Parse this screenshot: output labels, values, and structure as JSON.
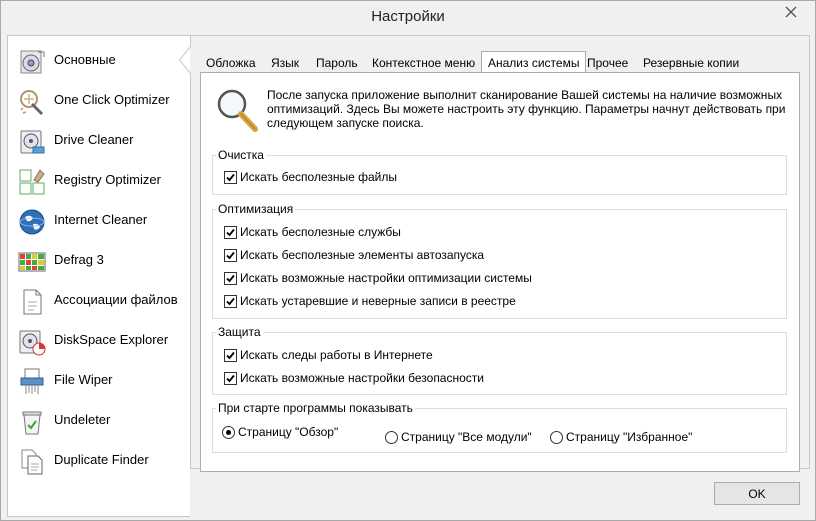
{
  "window": {
    "title": "Настройки"
  },
  "colors": {
    "accent": "#1e6fd9",
    "panel_border": "#acacac",
    "button_bg": "#e5e5e5"
  },
  "sidebar": {
    "items": [
      {
        "label": "Основные",
        "icon": "settings-disk-icon"
      },
      {
        "label": "One Click Optimizer",
        "icon": "magic-wand-icon"
      },
      {
        "label": "Drive Cleaner",
        "icon": "drive-cleaner-icon"
      },
      {
        "label": "Registry Optimizer",
        "icon": "registry-icon"
      },
      {
        "label": "Internet Cleaner",
        "icon": "globe-icon"
      },
      {
        "label": "Defrag 3",
        "icon": "defrag-grid-icon"
      },
      {
        "label": "Ассоциации файлов",
        "icon": "file-association-icon"
      },
      {
        "label": "DiskSpace Explorer",
        "icon": "disk-pie-icon"
      },
      {
        "label": "File Wiper",
        "icon": "shredder-icon"
      },
      {
        "label": "Undeleter",
        "icon": "recycle-bin-icon"
      },
      {
        "label": "Duplicate Finder",
        "icon": "duplicate-files-icon"
      }
    ]
  },
  "tabs": [
    {
      "label": "Обложка"
    },
    {
      "label": "Язык"
    },
    {
      "label": "Пароль"
    },
    {
      "label": "Контекстное меню"
    },
    {
      "label": "Анализ системы",
      "active": true
    },
    {
      "label": "Прочее"
    },
    {
      "label": "Резервные копии"
    }
  ],
  "info": {
    "icon": "magnifier-icon",
    "text": "После запуска приложение выполнит сканирование Вашей системы на наличие возможных оптимизаций. Здесь Вы можете настроить эту функцию. Параметры начнут действовать при следующем запуске поиска."
  },
  "groups": {
    "cleanup": {
      "title": "Очистка",
      "options": [
        {
          "label": "Искать бесполезные файлы",
          "checked": true
        }
      ]
    },
    "optimization": {
      "title": "Оптимизация",
      "options": [
        {
          "label": "Искать бесполезные службы",
          "checked": true
        },
        {
          "label": "Искать бесполезные элементы автозапуска",
          "checked": true
        },
        {
          "label": "Искать возможные настройки оптимизации системы",
          "checked": true
        },
        {
          "label": "Искать устаревшие и неверные записи в реестре",
          "checked": true
        }
      ]
    },
    "protection": {
      "title": "Защита",
      "options": [
        {
          "label": "Искать следы работы в Интернете",
          "checked": true
        },
        {
          "label": "Искать возможные настройки безопасности",
          "checked": true
        }
      ]
    },
    "startup": {
      "title": "При старте программы показывать",
      "options": [
        {
          "label": "Страницу \"Обзор\"",
          "selected": true
        },
        {
          "label": "Страницу \"Все модули\"",
          "selected": false
        },
        {
          "label": "Страницу \"Избранное\"",
          "selected": false
        }
      ]
    }
  },
  "buttons": {
    "ok": "OK"
  }
}
